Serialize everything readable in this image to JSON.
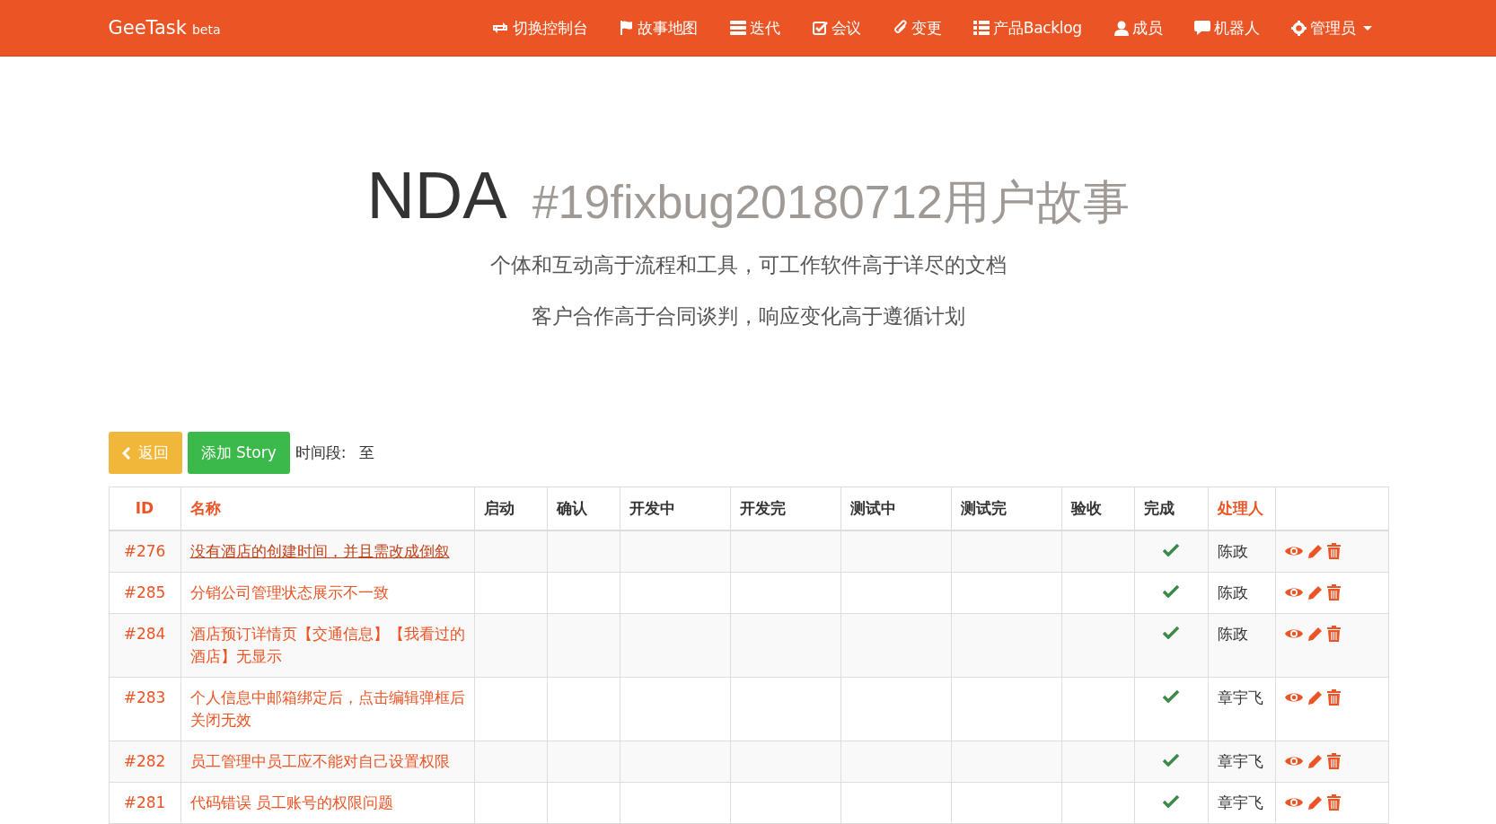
{
  "navbar": {
    "brand": "GeeTask",
    "brand_tag": "beta",
    "items": [
      {
        "label": "切换控制台"
      },
      {
        "label": "故事地图"
      },
      {
        "label": "迭代"
      },
      {
        "label": "会议"
      },
      {
        "label": "变更"
      },
      {
        "label": "产品Backlog"
      },
      {
        "label": "成员"
      },
      {
        "label": "机器人"
      },
      {
        "label": "管理员",
        "dropdown": true
      }
    ]
  },
  "hero": {
    "title": "NDA",
    "subtitle": "#19fixbug20180712用户故事",
    "lines": [
      "个体和互动高于流程和工具，可工作软件高于详尽的文档",
      "客户合作高于合同谈判，响应变化高于遵循计划"
    ]
  },
  "toolbar": {
    "back_button": "返回",
    "add_button": "添加 Story",
    "period_label": "时间段:",
    "period_to": "至"
  },
  "table": {
    "columns": [
      {
        "label": "ID",
        "sortable": true
      },
      {
        "label": "名称",
        "sortable": true
      },
      {
        "label": "启动",
        "sortable": false
      },
      {
        "label": "确认",
        "sortable": false
      },
      {
        "label": "开发中",
        "sortable": false
      },
      {
        "label": "开发完",
        "sortable": false
      },
      {
        "label": "测试中",
        "sortable": false
      },
      {
        "label": "测试完",
        "sortable": false
      },
      {
        "label": "验收",
        "sortable": false
      },
      {
        "label": "完成",
        "sortable": false
      },
      {
        "label": "处理人",
        "sortable": true
      }
    ],
    "rows": [
      {
        "id": "#276",
        "title": "没有酒店的创建时间，并且需改成倒叙",
        "hovered": true,
        "done": true,
        "assignee": "陈政"
      },
      {
        "id": "#285",
        "title": "分销公司管理状态展示不一致",
        "hovered": false,
        "done": true,
        "assignee": "陈政"
      },
      {
        "id": "#284",
        "title": "酒店预订详情页【交通信息】【我看过的酒店】无显示",
        "hovered": false,
        "done": true,
        "assignee": "陈政"
      },
      {
        "id": "#283",
        "title": "个人信息中邮箱绑定后，点击编辑弹框后关闭无效",
        "hovered": false,
        "done": true,
        "assignee": "章宇飞"
      },
      {
        "id": "#282",
        "title": "员工管理中员工应不能对自己设置权限",
        "hovered": false,
        "done": true,
        "assignee": "章宇飞"
      },
      {
        "id": "#281",
        "title": "代码错误 员工账号的权限问题",
        "hovered": false,
        "done": true,
        "assignee": "章宇飞"
      }
    ]
  }
}
